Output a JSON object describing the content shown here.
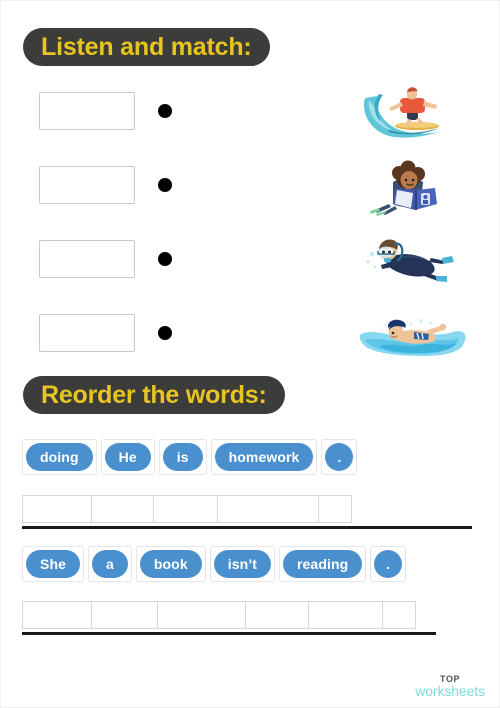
{
  "sections": {
    "listen": {
      "heading": "Listen and match:",
      "rows": [
        {
          "input_value": "",
          "input_placeholder": "",
          "dot": "match-dot",
          "picture": "surfing-boy-on-wave"
        },
        {
          "input_value": "",
          "input_placeholder": "",
          "dot": "match-dot",
          "picture": "girl-reading-book"
        },
        {
          "input_value": "",
          "input_placeholder": "",
          "dot": "match-dot",
          "picture": "boy-scuba-diving"
        },
        {
          "input_value": "",
          "input_placeholder": "",
          "dot": "match-dot",
          "picture": "person-swimming"
        }
      ]
    },
    "reorder": {
      "heading": "Reorder the words:",
      "sentences": [
        {
          "tiles": [
            "doing",
            "He",
            "is",
            "homework",
            "."
          ],
          "answer_cells": [
            "",
            "",
            "",
            "",
            ""
          ]
        },
        {
          "tiles": [
            "She",
            "a",
            "book",
            "isn’t",
            "reading",
            "."
          ],
          "answer_cells": [
            "",
            "",
            "",
            "",
            "",
            ""
          ]
        }
      ]
    }
  },
  "footer": {
    "logo_top": "TOP",
    "logo_bottom": "worksheets"
  },
  "colors": {
    "heading_pill_bg": "#3c3c3b",
    "heading_text": "#e8c520",
    "tile_bg": "#4a90ce",
    "tile_text": "#ffffff",
    "dot": "#000000",
    "rule": "#1a1a1a",
    "logo_top": "#4b5358",
    "logo_bottom": "#7fd9dd",
    "page_bg": "#ffffff"
  }
}
